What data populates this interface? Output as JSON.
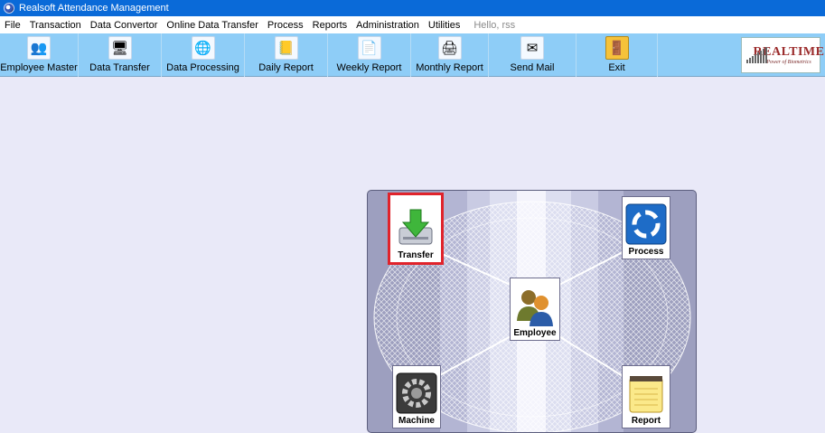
{
  "window": {
    "title": "Realsoft Attendance Management"
  },
  "menu": {
    "items": [
      "File",
      "Transaction",
      "Data Convertor",
      "Online Data Transfer",
      "Process",
      "Reports",
      "Administration",
      "Utilities"
    ],
    "greeting": "Hello, rss"
  },
  "toolbar": {
    "buttons": [
      {
        "label": "Employee Master",
        "icon": "employees-icon"
      },
      {
        "label": "Data Transfer",
        "icon": "computer-transfer-icon"
      },
      {
        "label": "Data Processing",
        "icon": "globe-icon"
      },
      {
        "label": "Daily Report",
        "icon": "notepad-icon"
      },
      {
        "label": "Weekly Report",
        "icon": "document-icon"
      },
      {
        "label": "Monthly Report",
        "icon": "printer-icon"
      },
      {
        "label": "Send Mail",
        "icon": "envelope-icon"
      },
      {
        "label": "Exit",
        "icon": "exit-door-icon"
      }
    ]
  },
  "logo": {
    "title": "REALTIME",
    "tagline": "Power of Biometrics"
  },
  "dashboard": {
    "nodes": {
      "transfer": {
        "label": "Transfer",
        "icon": "download-arrow-icon"
      },
      "process": {
        "label": "Process",
        "icon": "circular-arrows-icon"
      },
      "employee": {
        "label": "Employee",
        "icon": "users-icon"
      },
      "machine": {
        "label": "Machine",
        "icon": "gear-icon"
      },
      "report": {
        "label": "Report",
        "icon": "notepad-icon"
      }
    },
    "selected_node": "transfer"
  },
  "colors": {
    "title_bar": "#0a6ad8",
    "toolbar": "#8ecdf7",
    "background": "#e9e9f8",
    "selection": "#e0232b"
  }
}
